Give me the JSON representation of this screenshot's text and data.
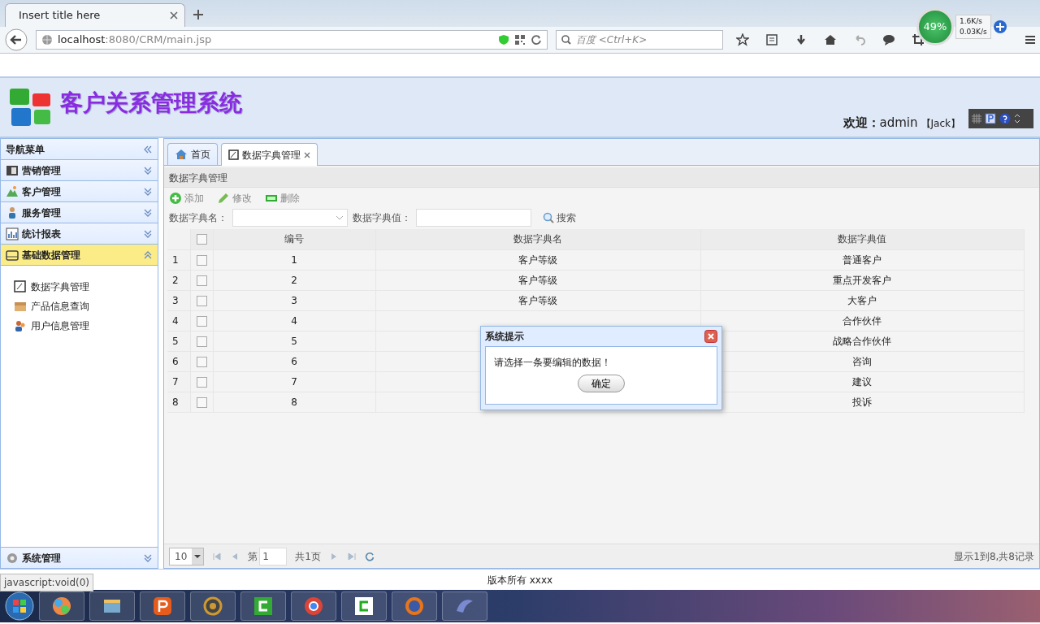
{
  "browser": {
    "tab_title": "Insert title here",
    "url_host": "localhost",
    "url_rest": ":8080/CRM/main.jsp",
    "search_placeholder": "百度 <Ctrl+K>",
    "net_widget": {
      "percent": "49%",
      "up": "1.6K/s",
      "down": "0.03K/s"
    }
  },
  "header": {
    "title": "客户关系管理系统",
    "welcome_label": "欢迎：",
    "user": "admin",
    "user_name": "【Jack】"
  },
  "sidebar": {
    "title": "导航菜单",
    "groups": [
      {
        "label": "营销管理",
        "expanded": false
      },
      {
        "label": "客户管理",
        "expanded": false
      },
      {
        "label": "服务管理",
        "expanded": false
      },
      {
        "label": "统计报表",
        "expanded": false
      },
      {
        "label": "基础数据管理",
        "expanded": true,
        "children": [
          {
            "label": "数据字典管理"
          },
          {
            "label": "产品信息查询"
          },
          {
            "label": "用户信息管理"
          }
        ]
      },
      {
        "label": "系统管理",
        "expanded": false
      }
    ]
  },
  "tabs": [
    {
      "label": "首页",
      "selected": false,
      "closable": false
    },
    {
      "label": "数据字典管理",
      "selected": true,
      "closable": true
    }
  ],
  "panel": {
    "title": "数据字典管理",
    "toolbar": [
      "添加",
      "修改",
      "删除"
    ],
    "filters": [
      {
        "label": "数据字典名：",
        "kind": "combo"
      },
      {
        "label": "数据字典值：",
        "kind": "text"
      }
    ],
    "search_button": "搜索",
    "table": {
      "header_checked": false,
      "columns": [
        "编号",
        "数据字典名",
        "数据字典值"
      ],
      "rows": [
        {
          "index": "1",
          "checked": false,
          "id": "1",
          "name": "客户等级",
          "value": "普通客户"
        },
        {
          "index": "2",
          "checked": false,
          "id": "2",
          "name": "客户等级",
          "value": "重点开发客户"
        },
        {
          "index": "3",
          "checked": false,
          "id": "3",
          "name": "客户等级",
          "value": "大客户"
        },
        {
          "index": "4",
          "checked": false,
          "id": "4",
          "value": "合作伙伴"
        },
        {
          "index": "5",
          "checked": false,
          "id": "5",
          "value": "战略合作伙伴"
        },
        {
          "index": "6",
          "checked": false,
          "id": "6",
          "value": "咨询"
        },
        {
          "index": "7",
          "checked": false,
          "id": "7",
          "value": "建议"
        },
        {
          "index": "8",
          "checked": false,
          "id": "8",
          "value": "投诉"
        }
      ]
    },
    "pager": {
      "page_size": "10",
      "page_label": "第",
      "page": "1",
      "total_pages": "共1页",
      "summary": "显示1到8,共8记录"
    }
  },
  "dialog": {
    "title": "系统提示",
    "message": "请选择一条要编辑的数据！",
    "button": "确定"
  },
  "status_url": "javascript:void(0)",
  "footer": "版本所有 xxxx"
}
